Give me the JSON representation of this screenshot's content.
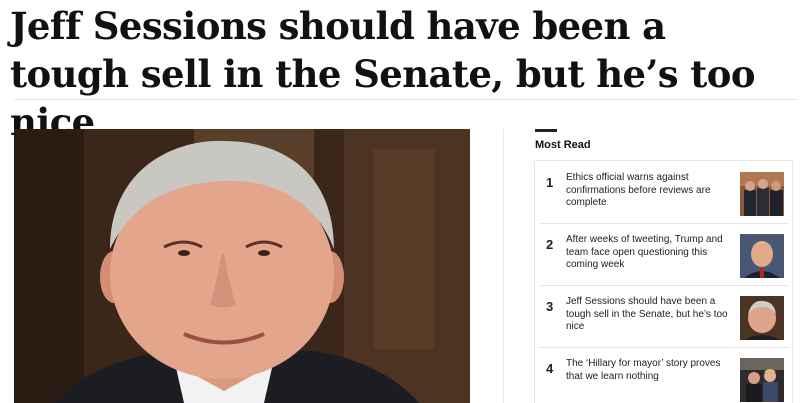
{
  "article": {
    "headline": "Jeff Sessions should have been a tough sell in the Senate, but he’s too nice"
  },
  "most_read": {
    "title": "Most Read",
    "items": [
      {
        "rank": "1",
        "text": "Ethics official warns against confirmations before reviews are complete"
      },
      {
        "rank": "2",
        "text": "After weeks of tweeting, Trump and team face open questioning this coming week"
      },
      {
        "rank": "3",
        "text": "Jeff Sessions should have been a tough sell in the Senate, but he’s too nice"
      },
      {
        "rank": "4",
        "text": "The ‘Hillary for mayor’ story proves that we learn nothing"
      }
    ]
  }
}
